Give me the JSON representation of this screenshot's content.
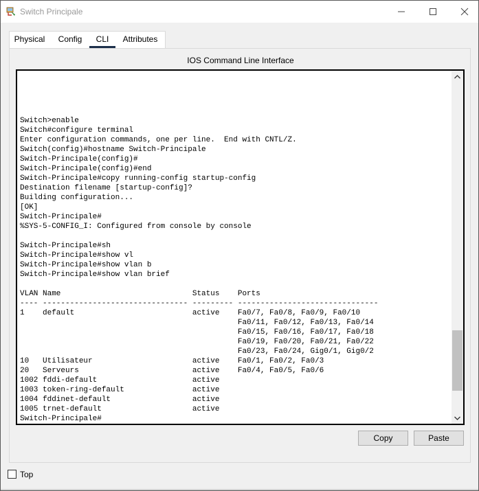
{
  "window": {
    "title": "Switch Principale",
    "minimize_glyph": "—",
    "maximize_glyph": "☐",
    "close_glyph": "✕"
  },
  "tabs": [
    {
      "label": "Physical",
      "selected": false
    },
    {
      "label": "Config",
      "selected": false
    },
    {
      "label": "CLI",
      "selected": true
    },
    {
      "label": "Attributes",
      "selected": false
    }
  ],
  "cli": {
    "header": "IOS Command Line Interface",
    "lines": [
      "Switch>enable",
      "Switch#configure terminal",
      "Enter configuration commands, one per line.  End with CNTL/Z.",
      "Switch(config)#hostname Switch-Principale",
      "Switch-Principale(config)#",
      "Switch-Principale(config)#end",
      "Switch-Principale#copy running-config startup-config",
      "Destination filename [startup-config]?",
      "Building configuration...",
      "[OK]",
      "Switch-Principale#",
      "%SYS-5-CONFIG_I: Configured from console by console",
      "",
      "Switch-Principale#sh",
      "Switch-Principale#show vl",
      "Switch-Principale#show vlan b",
      "Switch-Principale#show vlan brief",
      "",
      "VLAN Name                             Status    Ports",
      "---- -------------------------------- --------- -------------------------------",
      "1    default                          active    Fa0/7, Fa0/8, Fa0/9, Fa0/10",
      "                                                Fa0/11, Fa0/12, Fa0/13, Fa0/14",
      "                                                Fa0/15, Fa0/16, Fa0/17, Fa0/18",
      "                                                Fa0/19, Fa0/20, Fa0/21, Fa0/22",
      "                                                Fa0/23, Fa0/24, Gig0/1, Gig0/2",
      "10   Utilisateur                      active    Fa0/1, Fa0/2, Fa0/3",
      "20   Serveurs                         active    Fa0/4, Fa0/5, Fa0/6",
      "1002 fddi-default                     active",
      "1003 token-ring-default               active",
      "1004 fddinet-default                  active",
      "1005 trnet-default                    active",
      "Switch-Principale#"
    ]
  },
  "buttons": {
    "copy": "Copy",
    "paste": "Paste"
  },
  "footer": {
    "top_label": "Top",
    "top_checked": false
  },
  "colors": {
    "tab_underline": "#1c2f4a",
    "scroll_thumb": "#c1c1c1",
    "title_text": "#999999"
  }
}
